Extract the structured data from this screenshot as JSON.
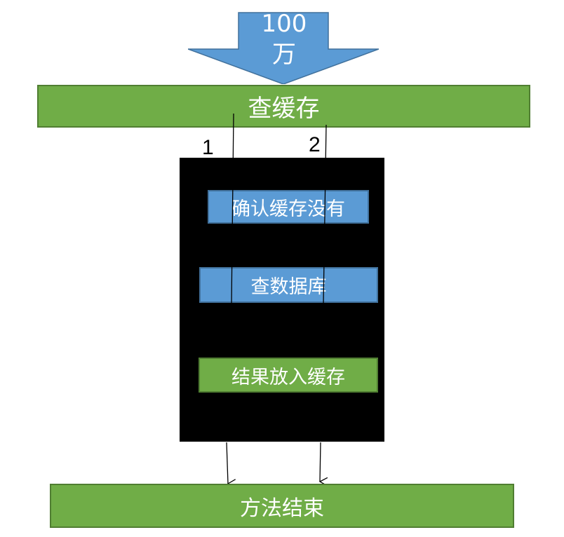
{
  "arrow": {
    "text": "100\n万",
    "fill": "#5b9bd5"
  },
  "top_bar": {
    "label": "查缓存"
  },
  "thread_labels": [
    "1",
    "2"
  ],
  "steps": [
    {
      "label": "确认缓存没有",
      "color": "blue"
    },
    {
      "label": "查数据库",
      "color": "blue"
    },
    {
      "label": "结果放入缓存",
      "color": "green"
    }
  ],
  "bottom_bar": {
    "label": "方法结束"
  },
  "colors": {
    "green": "#70ad47",
    "blue": "#5b9bd5",
    "box": "#000000"
  }
}
